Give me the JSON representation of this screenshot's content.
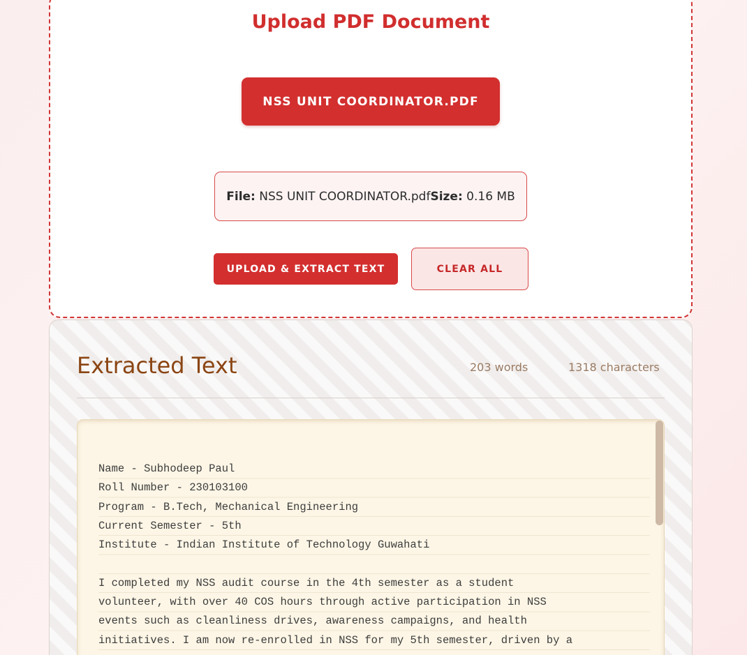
{
  "upload": {
    "title": "Upload PDF Document",
    "file_button_label": "NSS UNIT COORDINATOR.PDF",
    "file_label": "File:",
    "file_name": "NSS UNIT COORDINATOR.pdf",
    "size_label": "Size:",
    "size_value": "0.16 MB",
    "upload_button_label": "UPLOAD & EXTRACT TEXT",
    "clear_button_label": "CLEAR ALL"
  },
  "extracted": {
    "title": "Extracted Text",
    "word_count": "203 words",
    "char_count": "1318 characters",
    "text": "Name - Subhodeep Paul\nRoll Number - 230103100\nProgram - B.Tech, Mechanical Engineering\nCurrent Semester - 5th\nInstitute - Indian Institute of Technology Guwahati\n\nI completed my NSS audit course in the 4th semester as a student\nvolunteer, with over 40 COS hours through active participation in NSS\nevents such as cleanliness drives, awareness campaigns, and health\ninitiatives. I am now re-enrolled in NSS for my 5th semester, driven by a"
  },
  "colors": {
    "accent": "#d32f2f",
    "title_brown": "#8b4513",
    "paper": "#fdf6e6"
  }
}
